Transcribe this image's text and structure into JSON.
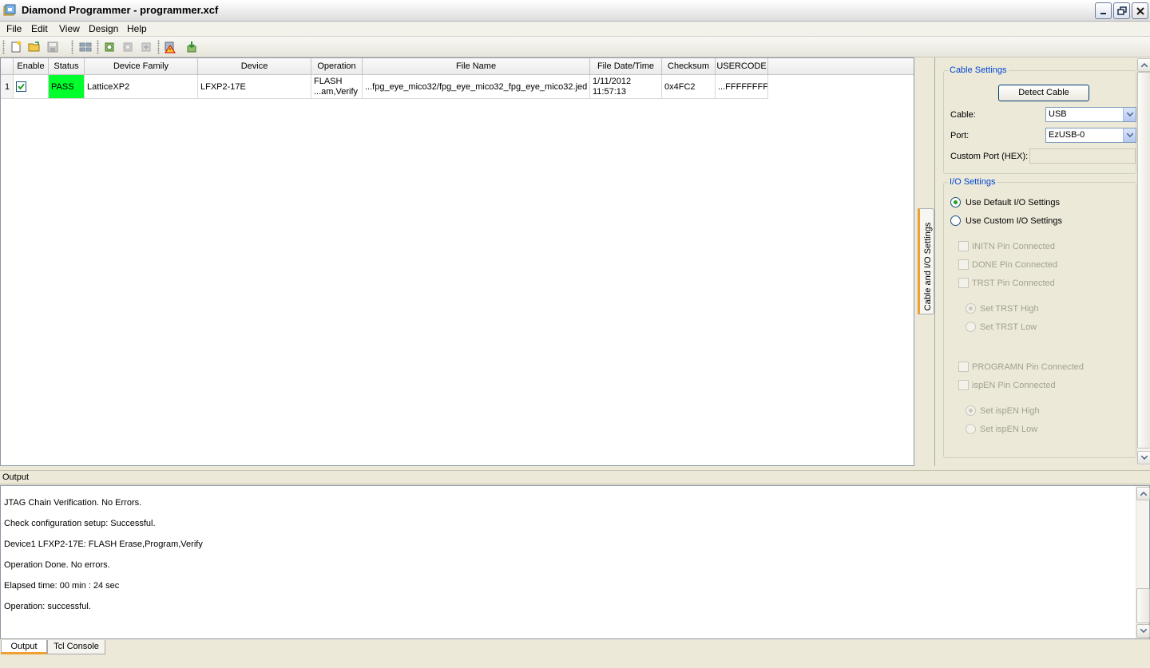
{
  "window": {
    "title": "Diamond Programmer - programmer.xcf"
  },
  "menu": [
    "File",
    "Edit",
    "View",
    "Design",
    "Help"
  ],
  "table": {
    "columns": [
      "Enable",
      "Status",
      "Device Family",
      "Device",
      "Operation",
      "File Name",
      "File Date/Time",
      "Checksum",
      "USERCODE"
    ],
    "rows": [
      {
        "index": "1",
        "enabled": true,
        "status": "PASS",
        "family": "LatticeXP2",
        "device": "LFXP2-17E",
        "operation_line1": "FLASH",
        "operation_line2": "...am,Verify",
        "file_name": "...fpg_eye_mico32/fpg_eye_mico32_fpg_eye_mico32.jed",
        "date_line1": "1/11/2012",
        "date_line2": "11:57:13",
        "checksum": "0x4FC2",
        "usercode": "...FFFFFFFF"
      }
    ],
    "status_color": "#00ff2c"
  },
  "side_tab_label": "Cable and I/O Settings",
  "cable_settings": {
    "title": "Cable Settings",
    "detect_button": "Detect Cable",
    "cable_label": "Cable:",
    "cable_value": "USB",
    "port_label": "Port:",
    "port_value": "EzUSB-0",
    "custom_port_label": "Custom Port (HEX):",
    "custom_port_value": ""
  },
  "io_settings": {
    "title": "I/O Settings",
    "use_default": "Use Default I/O Settings",
    "use_custom": "Use Custom I/O Settings",
    "initn": "INITN Pin Connected",
    "done": "DONE Pin Connected",
    "trst": "TRST Pin Connected",
    "trst_high": "Set TRST High",
    "trst_low": "Set TRST Low",
    "programn": "PROGRAMN Pin Connected",
    "ispen": "ispEN Pin Connected",
    "ispen_high": "Set ispEN High",
    "ispen_low": "Set ispEN Low"
  },
  "output": {
    "title": "Output",
    "lines": [
      "JTAG Chain Verification. No Errors.",
      "Check configuration setup: Successful.",
      "Device1 LFXP2-17E: FLASH Erase,Program,Verify",
      "Operation Done. No errors.",
      "Elapsed time: 00 min : 24 sec",
      "Operation: successful."
    ]
  },
  "bottom_tabs": [
    "Output",
    "Tcl Console"
  ],
  "colors": {
    "accent": "#0046d5",
    "tab_highlight": "#f0a030"
  }
}
